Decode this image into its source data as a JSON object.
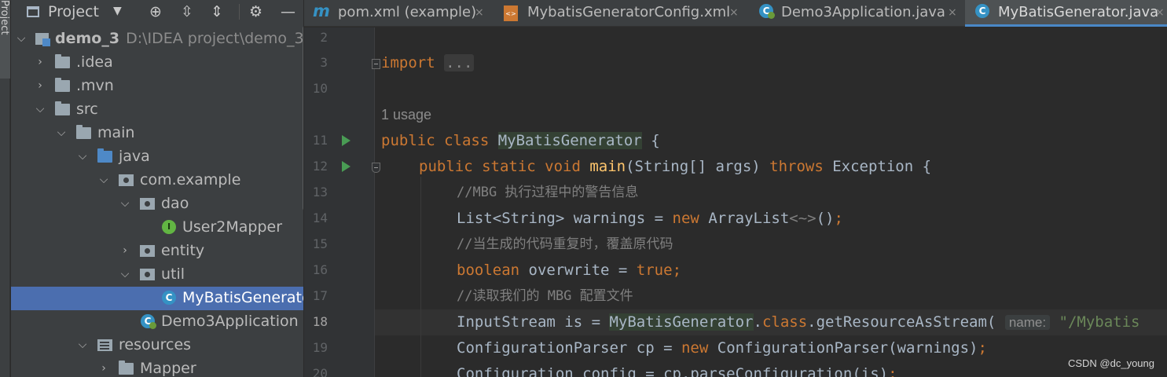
{
  "tool_strip": {
    "label": "Project"
  },
  "panel": {
    "title": "Project"
  },
  "tree": [
    {
      "label": "demo_3",
      "path": "D:\\IDEA project\\demo_3",
      "icon": "module-icon",
      "expanded": true
    },
    {
      "label": ".idea",
      "icon": "folder-icon",
      "expanded": false
    },
    {
      "label": ".mvn",
      "icon": "folder-icon",
      "expanded": false
    },
    {
      "label": "src",
      "icon": "folder-icon",
      "expanded": true
    },
    {
      "label": "main",
      "icon": "folder-icon",
      "expanded": true
    },
    {
      "label": "java",
      "icon": "source-folder-icon",
      "expanded": true
    },
    {
      "label": "com.example",
      "icon": "package-icon",
      "expanded": true
    },
    {
      "label": "dao",
      "icon": "package-icon",
      "expanded": true
    },
    {
      "label": "User2Mapper",
      "icon": "interface-icon"
    },
    {
      "label": "entity",
      "icon": "package-icon",
      "expanded": false
    },
    {
      "label": "util",
      "icon": "package-icon",
      "expanded": true
    },
    {
      "label": "MyBatisGenerator",
      "icon": "class-icon",
      "selected": true
    },
    {
      "label": "Demo3Application",
      "icon": "spring-class-icon"
    },
    {
      "label": "resources",
      "icon": "resources-folder-icon",
      "expanded": true
    },
    {
      "label": "Mapper",
      "icon": "folder-icon",
      "expanded": false
    }
  ],
  "tabs": [
    {
      "label": "pom.xml (example)",
      "icon": "maven-icon",
      "close": "×"
    },
    {
      "label": "MybatisGeneratorConfig.xml",
      "icon": "xml-icon",
      "close": "×"
    },
    {
      "label": "Demo3Application.java",
      "icon": "spring-class-icon",
      "close": "×"
    },
    {
      "label": "MyBatisGenerator.java",
      "icon": "class-icon",
      "close": "×",
      "active": true
    }
  ],
  "editor": {
    "line_numbers": [
      "2",
      "3",
      "10",
      "11",
      "12",
      "13",
      "14",
      "15",
      "16",
      "17",
      "18",
      "19",
      "20"
    ],
    "current_line": "18",
    "usage_hint": "1 usage",
    "code": {
      "l3_kw": "import",
      "l3_fold": "...",
      "l11_a": "public class ",
      "l11_name": "MyBatisGenerator",
      "l11_b": " {",
      "l12_a": "public static void ",
      "l12_fn": "main",
      "l12_b": "(String[] args) ",
      "l12_throws": "throws",
      "l12_c": " Exception {",
      "l13": "//MBG 执行过程中的警告信息",
      "l14_a": "List<String> warnings = ",
      "l14_new": "new",
      "l14_b": " ArrayList",
      "l14_diamond": "<~>",
      "l14_c": "()",
      "l14_semi": ";",
      "l15": "//当生成的代码重复时，覆盖原代码",
      "l16_kw": "boolean",
      "l16_a": " overwrite = ",
      "l16_true": "true",
      "l16_semi": ";",
      "l17": "//读取我们的 MBG 配置文件",
      "l18_a": "InputStream is = ",
      "l18_cls": "MyBatisGenerator",
      "l18_dot": ".",
      "l18_class": "class",
      "l18_b": ".getResourceAsStream(",
      "l18_hint": "name:",
      "l18_str": "\"/Mybatis",
      "l19_a": "ConfigurationParser cp = ",
      "l19_new": "new",
      "l19_b": " ConfigurationParser(warnings)",
      "l19_semi": ";",
      "l20_a": "Configuration config = cp.parseConfiguration(is)",
      "l20_semi": ";"
    }
  },
  "watermark": "CSDN @dc_young",
  "colors": {
    "accent": "#4b6eaf",
    "keyword": "#cc7832",
    "function": "#ffc66d",
    "comment": "#808080",
    "string": "#6a8759"
  }
}
